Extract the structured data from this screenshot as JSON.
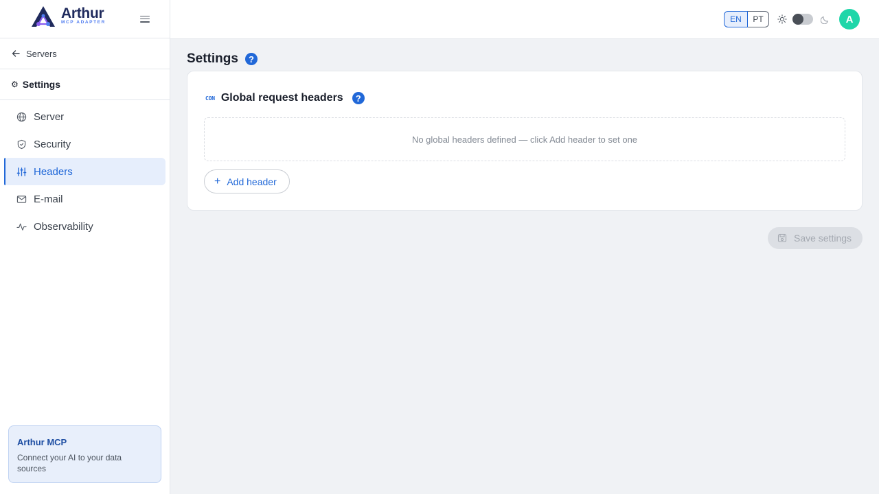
{
  "brand": {
    "name": "Arthur",
    "subtitle": "MCP ADAPTER"
  },
  "sidebar": {
    "back_label": "Servers",
    "section_title": "Settings",
    "items": [
      {
        "label": "Server",
        "icon": "globe-icon",
        "active": false
      },
      {
        "label": "Security",
        "icon": "shield-icon",
        "active": false
      },
      {
        "label": "Headers",
        "icon": "sliders-icon",
        "active": true
      },
      {
        "label": "E-mail",
        "icon": "mail-icon",
        "active": false
      },
      {
        "label": "Observability",
        "icon": "activity-icon",
        "active": false
      }
    ],
    "promo": {
      "title": "Arthur MCP",
      "text": "Connect your AI to your data sources"
    }
  },
  "topbar": {
    "languages": [
      "EN",
      "PT"
    ],
    "selected_language": "EN",
    "theme_dark": false,
    "avatar_initial": "A"
  },
  "main": {
    "title": "Settings",
    "help": "?",
    "card": {
      "badge": "CON",
      "title": "Global request headers",
      "empty_text": "No global headers defined — click Add header to set one",
      "add_label": "Add header"
    },
    "save_label": "Save settings"
  },
  "colors": {
    "accent": "#2168d8",
    "avatar": "#1ed6a9",
    "brand_dark": "#1f2a5c"
  }
}
